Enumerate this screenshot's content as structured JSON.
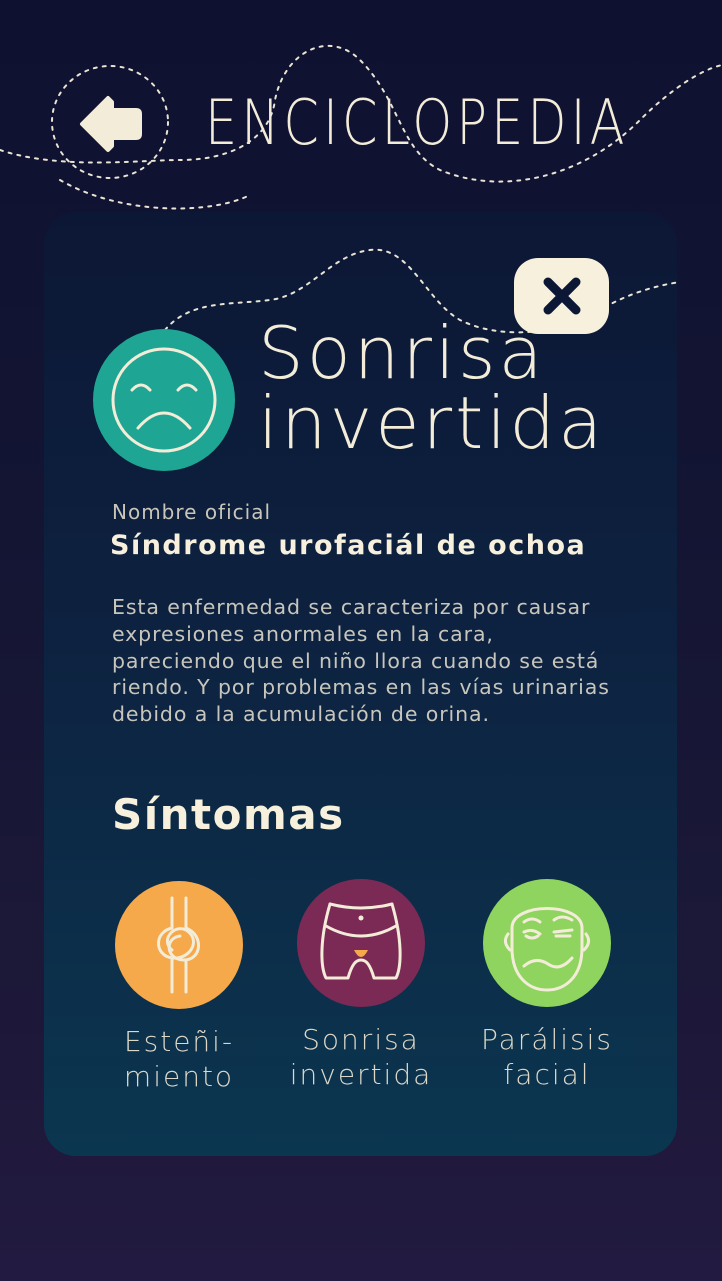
{
  "header": {
    "title": "ENCICLOPEDIA",
    "back_icon": "arrow-left-icon"
  },
  "card": {
    "close_label": "x",
    "disease": {
      "title_line1": "Sonrisa",
      "title_line2": "invertida",
      "icon": "sad-face-icon",
      "icon_color": "#1ea593",
      "official_label": "Nombre oficial",
      "official_name": "Síndrome urofaciál de ochoa",
      "description": "Esta enfermedad se caracteriza por causar expresiones anormales en la cara, pareciendo que el niño llora cuando se está riendo. Y por problemas en las vías urinarias debido a la acumulación de orina."
    },
    "symptoms_heading": "Síntomas",
    "symptoms": [
      {
        "line1": "Esteñi-",
        "line2": "miento",
        "icon": "knot-icon",
        "color": "#f5a94a"
      },
      {
        "line1": "Sonrisa",
        "line2": "invertida",
        "icon": "pelvis-icon",
        "color": "#7b2a55"
      },
      {
        "line1": "Parálisis",
        "line2": "facial",
        "icon": "paralyzed-face-icon",
        "color": "#8fd45e"
      }
    ]
  },
  "colors": {
    "background": "#0e1130",
    "card": "#0c1735",
    "text": "#f3ecd8"
  }
}
